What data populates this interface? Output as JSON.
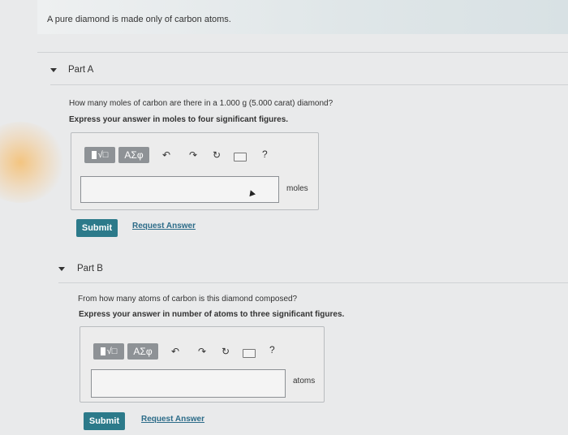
{
  "intro": {
    "text": "A pure diamond is made only of carbon atoms."
  },
  "partA": {
    "label": "Part A",
    "question": "How many moles of carbon are there in a 1.000 g (5.000 carat) diamond?",
    "instruction": "Express your answer in moles to four significant figures.",
    "toolbar": {
      "template_label": "√□",
      "greek_label": "ΑΣφ",
      "help_label": "?"
    },
    "answer_value": "",
    "unit": "moles",
    "submit_label": "Submit",
    "request_label": "Request Answer"
  },
  "partB": {
    "label": "Part B",
    "question": "From how many atoms of carbon is this diamond composed?",
    "instruction": "Express your answer in number of atoms to three significant figures.",
    "toolbar": {
      "template_label": "√□",
      "greek_label": "ΑΣφ",
      "help_label": "?"
    },
    "answer_value": "",
    "unit": "atoms",
    "submit_label": "Submit",
    "request_label": "Request Answer"
  },
  "colors": {
    "submit": "#2c7a8a",
    "link": "#2b6b88",
    "toolbar_button": "#8e9296"
  }
}
